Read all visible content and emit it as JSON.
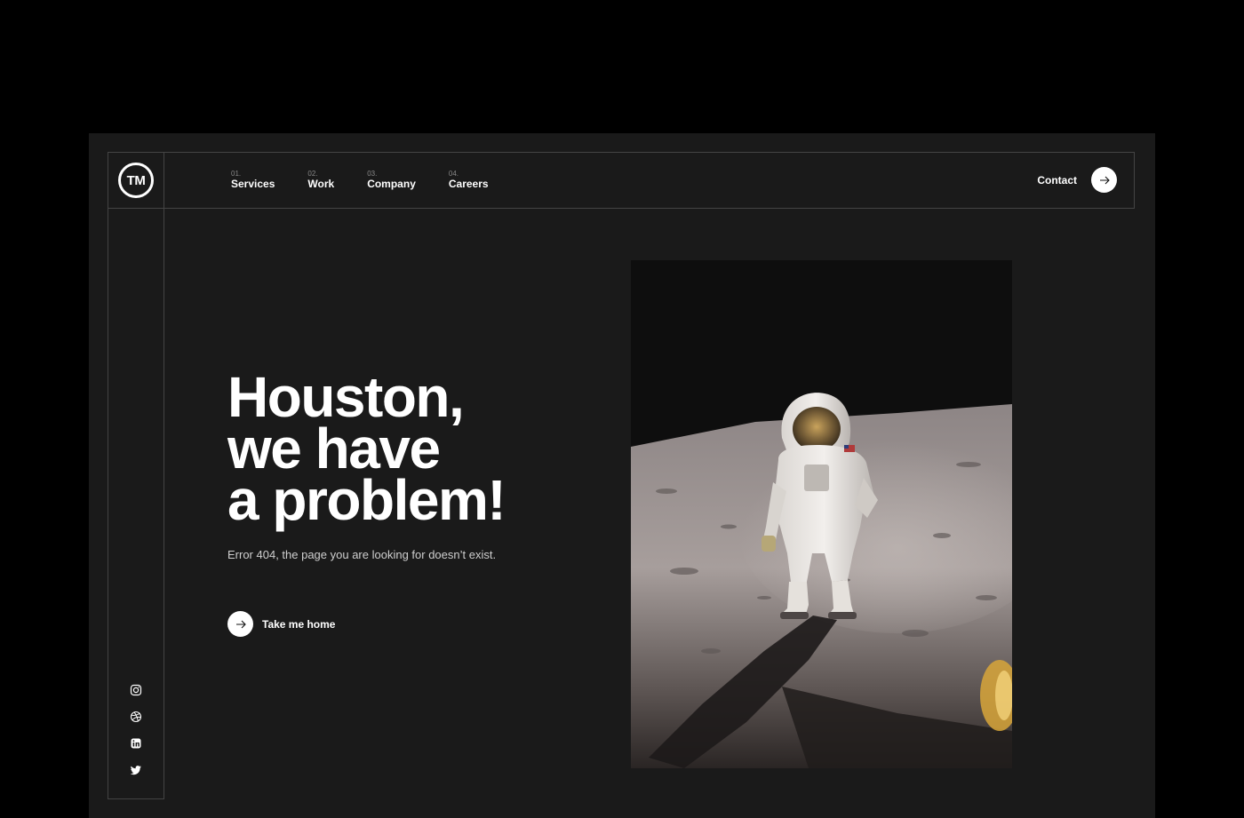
{
  "brand": {
    "logo_text": "TM"
  },
  "nav": {
    "items": [
      {
        "num": "01.",
        "label": "Services"
      },
      {
        "num": "02.",
        "label": "Work"
      },
      {
        "num": "03.",
        "label": "Company"
      },
      {
        "num": "04.",
        "label": "Careers"
      }
    ],
    "contact_label": "Contact"
  },
  "hero": {
    "headline_lines": [
      "Houston,",
      "we have",
      "a problem!"
    ],
    "subtext": "Error 404, the page you are looking for doesn’t exist.",
    "cta_label": "Take me home"
  },
  "social": {
    "icons": [
      "instagram-icon",
      "dribbble-icon",
      "linkedin-icon",
      "twitter-icon"
    ]
  },
  "colors": {
    "page_bg": "#000000",
    "panel_bg": "#1a1a1a",
    "border": "#444444",
    "text": "#ffffff",
    "muted": "#cfcfcf"
  }
}
